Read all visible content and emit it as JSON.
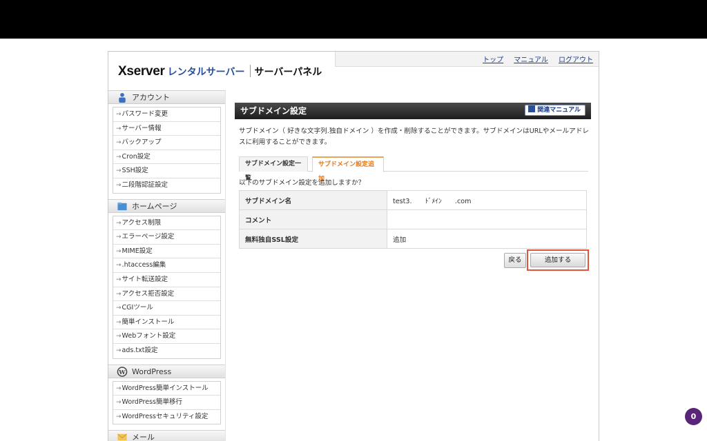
{
  "header": {
    "logo_brand": "Xserver",
    "logo_rental": "レンタルサーバー",
    "logo_panel": "サーバーパネル",
    "links": [
      "トップ",
      "マニュアル",
      "ログアウト"
    ]
  },
  "sidebar": {
    "account": {
      "title": "アカウント",
      "items": [
        "パスワード変更",
        "サーバー情報",
        "バックアップ",
        "Cron設定",
        "SSH設定",
        "二段階認証設定"
      ]
    },
    "homepage": {
      "title": "ホームページ",
      "items": [
        "アクセス制限",
        "エラーページ設定",
        "MIME設定",
        ".htaccess編集",
        "サイト転送設定",
        "アクセス拒否設定",
        "CGIツール",
        "簡単インストール",
        "Webフォント設定",
        "ads.txt設定"
      ]
    },
    "wordpress": {
      "title": "WordPress",
      "items": [
        "WordPress簡単インストール",
        "WordPress簡単移行",
        "WordPressセキュリティ設定"
      ]
    },
    "mail": {
      "title": "メール"
    }
  },
  "main": {
    "title": "サブドメイン設定",
    "manual_button": "関連マニュアル",
    "description": "サブドメイン（ 好きな文字列.独自ドメイン ）を作成・削除することができます。サブドメインはURLやメールアドレスに利用することができます。",
    "tabs": [
      "サブドメイン設定一覧",
      "サブドメイン設定追加"
    ],
    "question": "以下のサブドメイン設定を追加しますか？",
    "rows": [
      {
        "label": "サブドメイン名",
        "value": "test3.　　ﾄﾞﾒｲﾝ　　.com"
      },
      {
        "label": "コメント",
        "value": ""
      },
      {
        "label": "無料独自SSL設定",
        "value": "追加"
      }
    ],
    "back_button": "戻る",
    "add_button": "追加する"
  },
  "notification_badge": "0"
}
